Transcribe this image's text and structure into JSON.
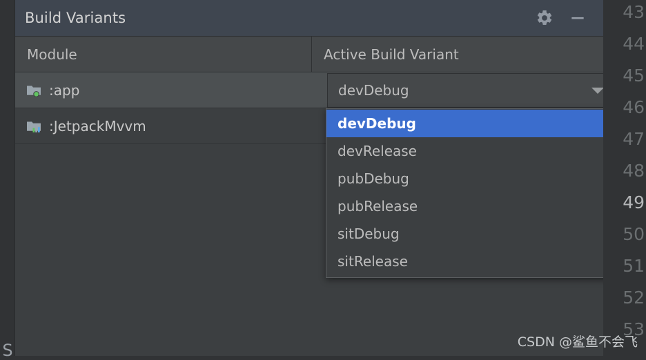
{
  "window": {
    "title": "Build Variants",
    "settings_icon": "gear-icon",
    "minimize_icon": "minimize-icon"
  },
  "table": {
    "columns": [
      {
        "label": "Module"
      },
      {
        "label": "Active Build Variant"
      }
    ],
    "rows": [
      {
        "module": ":app",
        "icon": "android-app-module-icon",
        "variant": "devDebug",
        "selected": true
      },
      {
        "module": ":JetpackMvvm",
        "icon": "android-library-module-icon",
        "variant": "",
        "selected": false
      }
    ]
  },
  "combo": {
    "value": "devDebug",
    "arrow_icon": "chevron-down-icon",
    "expanded": true
  },
  "dropdown": {
    "options": [
      "devDebug",
      "devRelease",
      "pubDebug",
      "pubRelease",
      "sitDebug",
      "sitRelease"
    ],
    "highlighted": "devDebug"
  },
  "editor_gutter": {
    "line_numbers": [
      "43",
      "44",
      "45",
      "46",
      "47",
      "48",
      "49",
      "50",
      "51",
      "52",
      "53"
    ],
    "current_line": "49"
  },
  "left_strip": {
    "label": "S"
  },
  "watermark": {
    "text": "CSDN @鲨鱼不会飞"
  },
  "colors": {
    "accent_selection": "#3b6dcd",
    "panel_background": "#3c3f41",
    "titlebar_background": "#3f4650",
    "header_background": "#45484a",
    "row_selected": "#4c5052",
    "module_status_dot": "#62c462",
    "text_primary": "#bdbdbd"
  }
}
